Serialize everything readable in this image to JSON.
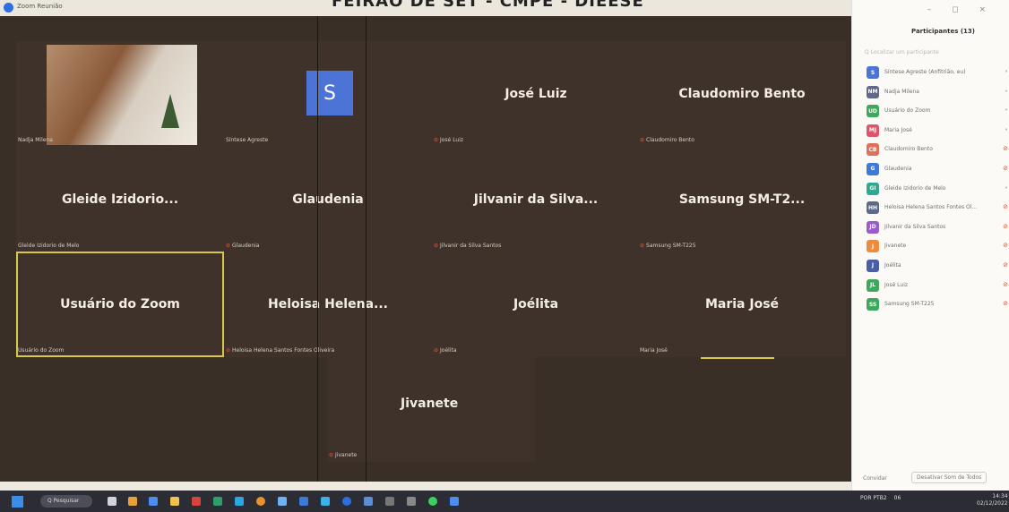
{
  "window": {
    "app_title": "Zoom Reunião",
    "banner_text": "FEIRÃO DE SET - CMPE - DIEESE"
  },
  "grid": {
    "tiles": [
      {
        "display_name": "",
        "label": "Nadja Milena",
        "muted": false
      },
      {
        "display_name": "",
        "label": "Síntese Agreste",
        "avatar_letter": "S",
        "muted": false
      },
      {
        "display_name": "José Luiz",
        "label": "José Luiz",
        "muted": true
      },
      {
        "display_name": "Claudomiro Bento",
        "label": "Claudomiro Bento",
        "muted": true
      },
      {
        "display_name": "Gleide Izidorio...",
        "label": "Gleide Izidorio de Melo",
        "muted": false
      },
      {
        "display_name": "Glaudenia",
        "label": "Glaudenia",
        "muted": true
      },
      {
        "display_name": "Jilvanir da Silva...",
        "label": "Jilvanir da Silva Santos",
        "muted": true
      },
      {
        "display_name": "Samsung SM-T2...",
        "label": "Samsung SM-T225",
        "muted": true
      },
      {
        "display_name": "Usuário do Zoom",
        "label": "Usuário do Zoom",
        "muted": false
      },
      {
        "display_name": "Heloisa Helena...",
        "label": "Heloisa Helena Santos Fontes Oliveira",
        "muted": true
      },
      {
        "display_name": "Joélita",
        "label": "Joélita",
        "muted": true
      },
      {
        "display_name": "Maria José",
        "label": "Maria José",
        "muted": false
      },
      {
        "display_name": "Jivanete",
        "label": "Jivanete",
        "muted": true
      }
    ]
  },
  "participants": {
    "title": "Participantes (13)",
    "search_placeholder": "Q Localizar um participante",
    "list": [
      {
        "initials": "S",
        "name": "Síntese Agreste (Anfitrião, eu)",
        "color": "#4b74d6",
        "muted": false
      },
      {
        "initials": "NM",
        "name": "Nadja Milena",
        "color": "#5f6a8a",
        "muted": false
      },
      {
        "initials": "UD",
        "name": "Usuário do Zoom",
        "color": "#3fa85c",
        "muted": false
      },
      {
        "initials": "MJ",
        "name": "Maria José",
        "color": "#e0546a",
        "muted": false
      },
      {
        "initials": "CB",
        "name": "Claudomiro Bento",
        "color": "#e0705a",
        "muted": true
      },
      {
        "initials": "G",
        "name": "Glaudenia",
        "color": "#3e78d8",
        "muted": true
      },
      {
        "initials": "GI",
        "name": "Gleide Izidorio de Melo",
        "color": "#2fa88e",
        "muted": false
      },
      {
        "initials": "HH",
        "name": "Heloisa Helena Santos Fontes Ol...",
        "color": "#5c6a8a",
        "muted": true
      },
      {
        "initials": "JD",
        "name": "Jilvanir da Silva Santos",
        "color": "#9b5ad0",
        "muted": true
      },
      {
        "initials": "J",
        "name": "Jivanete",
        "color": "#f08a3c",
        "muted": true
      },
      {
        "initials": "J",
        "name": "Joélita",
        "color": "#4a5ea8",
        "muted": true
      },
      {
        "initials": "JL",
        "name": "José Luiz",
        "color": "#3fa85c",
        "muted": true
      },
      {
        "initials": "SS",
        "name": "Samsung SM-T225",
        "color": "#3fa85c",
        "muted": true
      }
    ],
    "footer_left": "Convidar",
    "footer_button": "Desativar Som de Todos"
  },
  "taskbar": {
    "search_label": "Q Pesquisar",
    "tray_lang": "POR PTB2",
    "tray_text": "06",
    "clock_time": "14:34",
    "clock_date": "02/12/2022"
  }
}
